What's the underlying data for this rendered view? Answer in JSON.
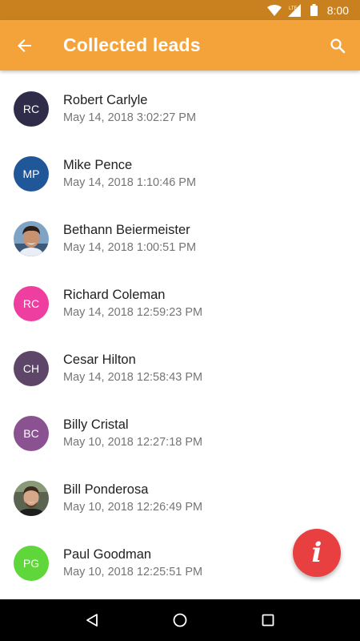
{
  "status_bar": {
    "network": "LTE",
    "time": "8:00"
  },
  "app_bar": {
    "title": "Collected leads",
    "back_icon": "arrow-back-icon",
    "search_icon": "search-icon"
  },
  "colors": {
    "status_bar": "#c9811f",
    "app_bar": "#f4a23a",
    "fab": "#e84040"
  },
  "leads": [
    {
      "initials": "RC",
      "name": "Robert Carlyle",
      "date": "May 14, 2018 3:02:27 PM",
      "avatar_color": "#2f2c4a",
      "photo": false
    },
    {
      "initials": "MP",
      "name": "Mike Pence",
      "date": "May 14, 2018 1:10:46 PM",
      "avatar_color": "#1f5799",
      "photo": false
    },
    {
      "initials": "",
      "name": "Bethann Beiermeister",
      "date": "May 14, 2018 1:00:51 PM",
      "avatar_color": "#6b8fb0",
      "photo": true
    },
    {
      "initials": "RC",
      "name": "Richard Coleman",
      "date": "May 14, 2018 12:59:23 PM",
      "avatar_color": "#ee3ea0",
      "photo": false
    },
    {
      "initials": "CH",
      "name": "Cesar Hilton",
      "date": "May 14, 2018 12:58:43 PM",
      "avatar_color": "#5d4668",
      "photo": false
    },
    {
      "initials": "BC",
      "name": "Billy Cristal",
      "date": "May 10, 2018 12:27:18 PM",
      "avatar_color": "#8b5292",
      "photo": false
    },
    {
      "initials": "",
      "name": "Bill Ponderosa",
      "date": "May 10, 2018 12:26:49 PM",
      "avatar_color": "#4a5242",
      "photo": true
    },
    {
      "initials": "PG",
      "name": "Paul Goodman",
      "date": "May 10, 2018 12:25:51 PM",
      "avatar_color": "#5fd63a",
      "photo": false
    }
  ],
  "fab": {
    "label": "i",
    "icon": "info-icon"
  },
  "nav_bar": {
    "back_icon": "nav-back-icon",
    "home_icon": "nav-home-icon",
    "recents_icon": "nav-recents-icon"
  }
}
